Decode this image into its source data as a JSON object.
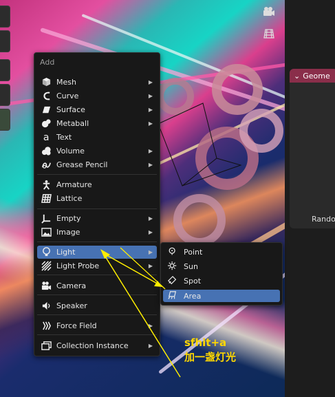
{
  "menu": {
    "title": "Add",
    "items": [
      {
        "label": "Mesh",
        "icon": "mesh-icon",
        "submenu": true
      },
      {
        "label": "Curve",
        "icon": "curve-icon",
        "submenu": true
      },
      {
        "label": "Surface",
        "icon": "surface-icon",
        "submenu": true
      },
      {
        "label": "Metaball",
        "icon": "metaball-icon",
        "submenu": true
      },
      {
        "label": "Text",
        "icon": "text-icon",
        "submenu": false
      },
      {
        "label": "Volume",
        "icon": "volume-icon",
        "submenu": true
      },
      {
        "label": "Grease Pencil",
        "icon": "grease-pencil-icon",
        "submenu": true
      },
      {
        "label": "Armature",
        "icon": "armature-icon",
        "submenu": false
      },
      {
        "label": "Lattice",
        "icon": "lattice-icon",
        "submenu": false
      },
      {
        "label": "Empty",
        "icon": "empty-icon",
        "submenu": true
      },
      {
        "label": "Image",
        "icon": "image-icon",
        "submenu": true
      },
      {
        "label": "Light",
        "icon": "light-icon",
        "submenu": true,
        "active": true
      },
      {
        "label": "Light Probe",
        "icon": "light-probe-icon",
        "submenu": true
      },
      {
        "label": "Camera",
        "icon": "camera-icon",
        "submenu": false
      },
      {
        "label": "Speaker",
        "icon": "speaker-icon",
        "submenu": false
      },
      {
        "label": "Force Field",
        "icon": "force-field-icon",
        "submenu": true
      },
      {
        "label": "Collection Instance",
        "icon": "collection-instance-icon",
        "submenu": true
      }
    ]
  },
  "light_submenu": {
    "items": [
      {
        "label": "Point",
        "icon": "point-light-icon"
      },
      {
        "label": "Sun",
        "icon": "sun-light-icon"
      },
      {
        "label": "Spot",
        "icon": "spot-light-icon"
      },
      {
        "label": "Area",
        "icon": "area-light-icon",
        "active": true
      }
    ]
  },
  "node_panel": {
    "header": "Geome",
    "field": "Rando"
  },
  "annotation": {
    "line1": "sfhit+a",
    "line2": "加一盏灯光"
  },
  "colors": {
    "accent": "#4772b3",
    "annotation": "#ffd700",
    "node_header": "#8a2e4a"
  }
}
